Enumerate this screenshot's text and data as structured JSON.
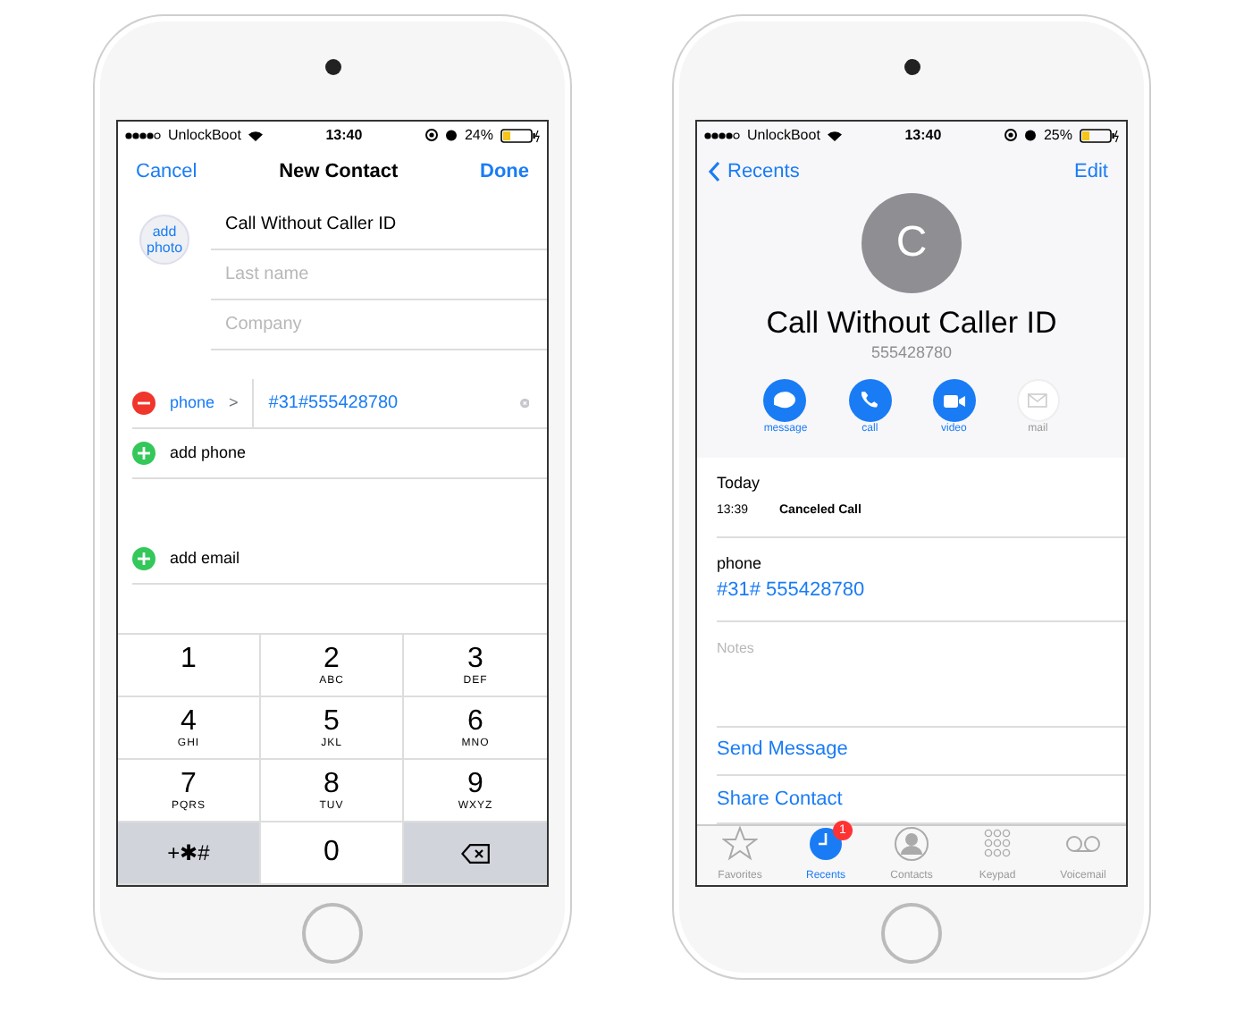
{
  "new_contact_screen": {
    "status_bar": {
      "carrier": "UnlockBoot",
      "time": "13:40",
      "battery": "24%",
      "battery_level": {
        "level": 0.24
      }
    },
    "nav": {
      "cancel": "Cancel",
      "title": "New Contact",
      "done": "Done"
    },
    "add_photo": "add photo",
    "fields": [
      {
        "value": "Call Without Caller ID"
      },
      {
        "placeholder": "Last name"
      },
      {
        "placeholder": "Company"
      }
    ],
    "phone_row": {
      "label": "phone",
      "chevron": ">",
      "value": "#31#555428780"
    },
    "add_rows": [
      {
        "label": "add phone"
      },
      {
        "label": "add email"
      }
    ],
    "keypad": [
      {
        "kind": "digit",
        "digit": "1"
      },
      {
        "kind": "digit",
        "digit": "2",
        "letters": "ABC"
      },
      {
        "kind": "digit",
        "digit": "3",
        "letters": "DEF"
      },
      {
        "kind": "digit",
        "digit": "4",
        "letters": "GHI"
      },
      {
        "kind": "digit",
        "digit": "5",
        "letters": "JKL"
      },
      {
        "kind": "digit",
        "digit": "6",
        "letters": "MNO"
      },
      {
        "kind": "digit",
        "digit": "7",
        "letters": "PQRS"
      },
      {
        "kind": "digit",
        "digit": "8",
        "letters": "TUV"
      },
      {
        "kind": "digit",
        "digit": "9",
        "letters": "WXYZ"
      },
      {
        "kind": "symbols",
        "digit": "+✱#"
      },
      {
        "kind": "digit",
        "digit": "0"
      },
      {
        "kind": "delete"
      }
    ]
  },
  "contact_detail_screen": {
    "status_bar": {
      "carrier": "UnlockBoot",
      "time": "13:40",
      "battery": "25%",
      "battery_level": {
        "level": 0.25
      }
    },
    "nav": {
      "back": "Recents",
      "edit": "Edit"
    },
    "avatar_initial": "C",
    "name": "Call Without Caller ID",
    "number": "555428780",
    "actions": [
      {
        "label": "message",
        "disabled": false
      },
      {
        "label": "call",
        "disabled": false
      },
      {
        "label": "video",
        "disabled": false
      },
      {
        "label": "mail",
        "disabled": true
      }
    ],
    "history": {
      "day": "Today",
      "time": "13:39",
      "status": "Canceled Call"
    },
    "phone": {
      "label": "phone",
      "value": "#31# 555428780"
    },
    "notes_placeholder": "Notes",
    "links": [
      "Send Message",
      "Share Contact"
    ],
    "tabs": [
      {
        "label": "Favorites",
        "selected": false
      },
      {
        "label": "Recents",
        "selected": true,
        "badge": "1"
      },
      {
        "label": "Contacts",
        "selected": false
      },
      {
        "label": "Keypad",
        "selected": false
      },
      {
        "label": "Voicemail",
        "selected": false
      }
    ]
  }
}
